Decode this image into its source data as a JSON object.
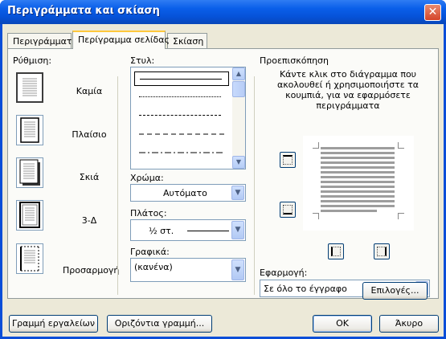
{
  "window": {
    "title": "Περιγράμματα και σκίαση",
    "close_label": "✕"
  },
  "tabs": [
    {
      "label": "Περιγράμματα"
    },
    {
      "label": "Περίγραμμα σελίδας"
    },
    {
      "label": "Σκίαση"
    }
  ],
  "setting": {
    "label": "Ρύθμιση:",
    "items": [
      {
        "label": "Καμία"
      },
      {
        "label": "Πλαίσιο"
      },
      {
        "label": "Σκιά"
      },
      {
        "label": "3-Δ"
      },
      {
        "label": "Προσαρμογή"
      }
    ]
  },
  "style": {
    "label": "Στυλ:"
  },
  "color": {
    "label": "Χρώμα:",
    "value": "Αυτόματο"
  },
  "width": {
    "label": "Πλάτος:",
    "value": "½ στ."
  },
  "art": {
    "label": "Γραφικά:",
    "value": "(κανένα)"
  },
  "preview": {
    "label": "Προεπισκόπηση",
    "hint": "Κάντε κλικ στο διάγραμμα που ακολουθεί ή χρησιμοποιήστε τα κουμπιά, για να εφαρμόσετε περιγράμματα"
  },
  "apply": {
    "label": "Εφαρμογή:",
    "value": "Σε όλο το έγγραφο"
  },
  "options_button": "Επιλογές...",
  "footer": {
    "toolbar_button": "Γραμμή εργαλείων",
    "hline_button": "Οριζόντια γραμμή...",
    "ok_button": "OK",
    "cancel_button": "Άκυρο"
  },
  "colors": {
    "title_bar": "#0a5fe9",
    "dialog_bg": "#ece9d8",
    "tab_highlight": "#ffc83c"
  }
}
